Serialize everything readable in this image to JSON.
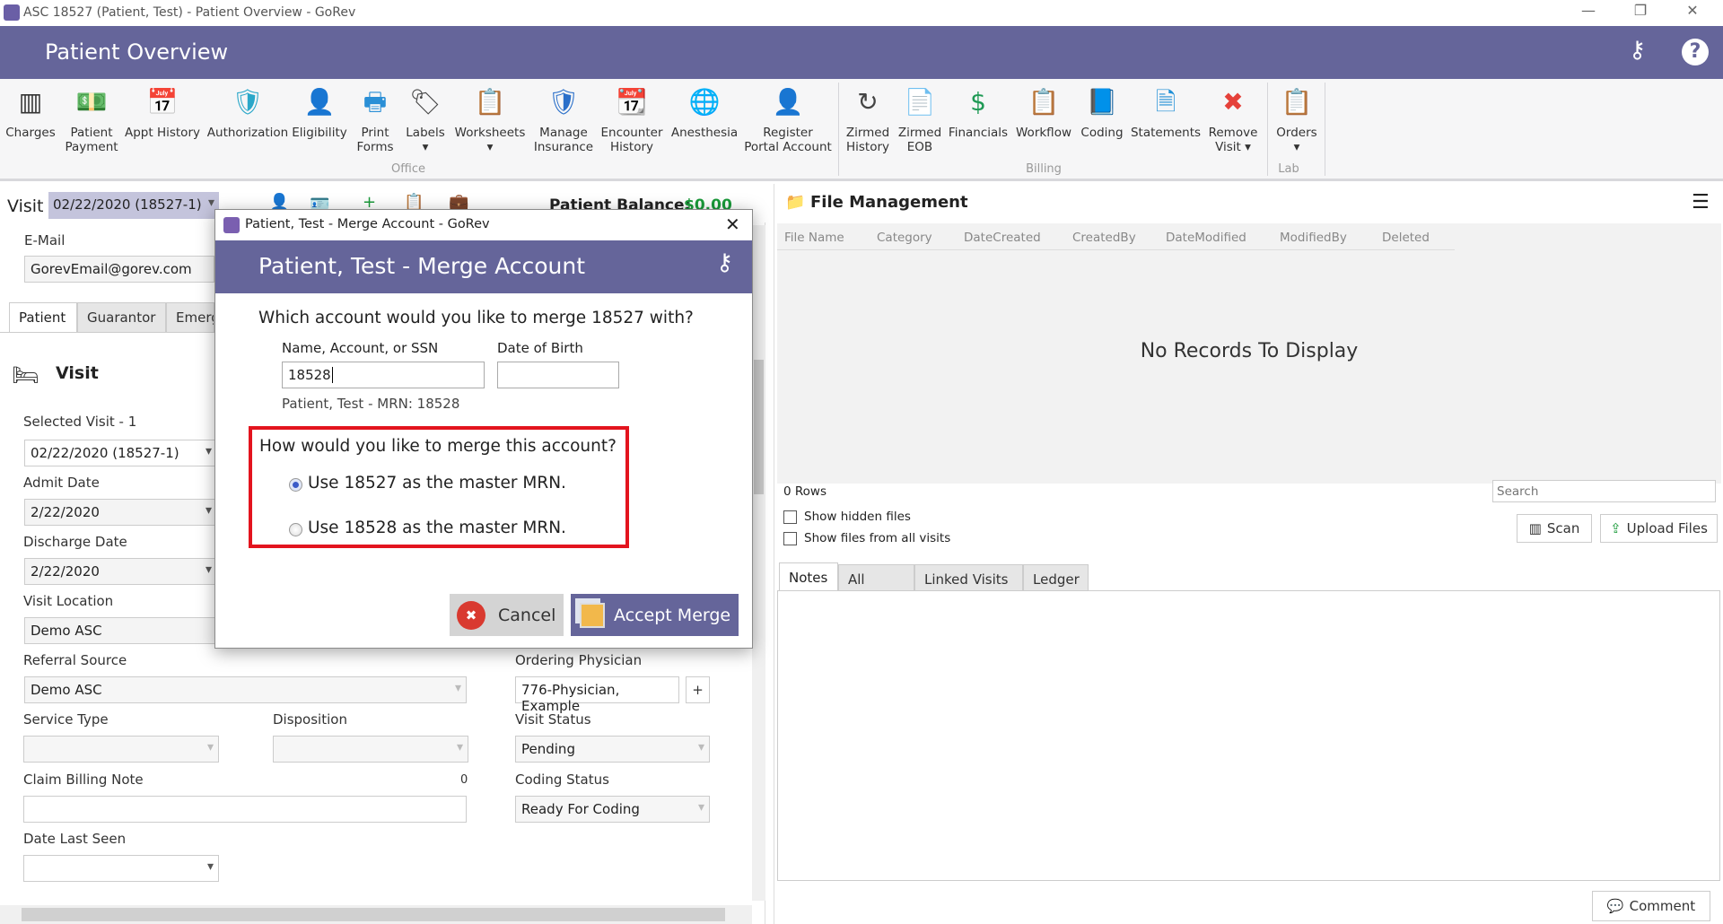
{
  "window": {
    "title": "ASC 18527 (Patient, Test) - Patient Overview - GoRev",
    "minimize": "—",
    "restore": "❐",
    "close": "✕"
  },
  "header": {
    "title": "Patient Overview",
    "keys_icon": "keys-icon",
    "help_icon": "help-icon"
  },
  "ribbon": {
    "items": [
      {
        "label": "Charges",
        "icon": "barcode-icon",
        "glyph": "▥",
        "color": "#333333"
      },
      {
        "label": "Patient\nPayment",
        "icon": "payment-icon",
        "glyph": "💵",
        "color": "#2a9a4a"
      },
      {
        "label": "Appt History",
        "icon": "calendar-clock-icon",
        "glyph": "📅",
        "color": "#d33"
      },
      {
        "label": "Authorization",
        "icon": "shield-check-icon",
        "glyph": "🛡",
        "color": "#2aa7c9"
      },
      {
        "label": "Eligibility",
        "icon": "user-check-icon",
        "glyph": "👤",
        "color": "#333"
      },
      {
        "label": "Print\nForms",
        "icon": "printer-icon",
        "glyph": "🖶",
        "color": "#2a8fd6"
      },
      {
        "label": "Labels\n▾",
        "icon": "tag-icon",
        "glyph": "🏷",
        "color": "#444"
      },
      {
        "label": "Worksheets\n▾",
        "icon": "worksheets-icon",
        "glyph": "📋",
        "color": "#e07b2a"
      },
      {
        "label": "Manage\nInsurance",
        "icon": "insurance-icon",
        "glyph": "🛡",
        "color": "#2a6fc9"
      },
      {
        "label": "Encounter\nHistory",
        "icon": "encounter-history-icon",
        "glyph": "📆",
        "color": "#2a9a4a"
      },
      {
        "label": "Anesthesia",
        "icon": "anesthesia-icon",
        "glyph": "🌐",
        "color": "#1f63c4"
      },
      {
        "label": "Register\nPortal Account",
        "icon": "register-user-icon",
        "glyph": "👤",
        "color": "#333"
      },
      {
        "label": "Zirmed\nHistory",
        "icon": "history-icon",
        "glyph": "↻",
        "color": "#444"
      },
      {
        "label": "Zirmed\nEOB",
        "icon": "eob-icon",
        "glyph": "📄",
        "color": "#e07b2a"
      },
      {
        "label": "Financials",
        "icon": "dollar-icon",
        "glyph": "$",
        "color": "#1f9a55"
      },
      {
        "label": "Workflow",
        "icon": "workflow-icon",
        "glyph": "📋",
        "color": "#2a8fd6"
      },
      {
        "label": "Coding",
        "icon": "book-icon",
        "glyph": "📘",
        "color": "#2a6fc9"
      },
      {
        "label": "Statements",
        "icon": "statements-icon",
        "glyph": "🗎",
        "color": "#1f8fd6"
      },
      {
        "label": "Remove\nVisit ▾",
        "icon": "remove-icon",
        "glyph": "✖",
        "color": "#e5413a"
      },
      {
        "label": "Orders\n▾",
        "icon": "orders-icon",
        "glyph": "📋",
        "color": "#e07b2a"
      }
    ],
    "groups": [
      "Office",
      "Billing",
      "Lab"
    ]
  },
  "visitbar": {
    "label": "Visit",
    "value": "02/22/2020 (18527-1)",
    "balance_label": "Patient Balance:",
    "balance": "$0.00"
  },
  "left": {
    "email_label": "E-Mail",
    "email": "GorevEmail@gorev.com",
    "tabs": [
      "Patient",
      "Guarantor",
      "Emerg"
    ],
    "section": "Visit",
    "selected_visit_label": "Selected Visit - 1",
    "selected_visit": "02/22/2020 (18527-1)",
    "admit_label": "Admit Date",
    "admit": "2/22/2020",
    "discharge_label": "Discharge Date",
    "discharge": "2/22/2020",
    "location_label": "Visit Location",
    "location": "Demo ASC",
    "referral_label": "Referral Source",
    "referral": "Demo ASC",
    "ordering_label": "Ordering Physician",
    "ordering": "776-Physician, Example",
    "add": "+",
    "service_label": "Service Type",
    "disposition_label": "Disposition",
    "status_label": "Visit Status",
    "status": "Pending",
    "claim_note_label": "Claim Billing Note",
    "claim_note_count": "0",
    "coding_label": "Coding Status",
    "coding": "Ready For Coding",
    "last_seen_label": "Date Last Seen"
  },
  "right": {
    "title": "File Management",
    "columns": [
      "File Name",
      "Category",
      "DateCreated",
      "CreatedBy",
      "DateModified",
      "ModifiedBy",
      "Deleted"
    ],
    "empty": "No Records To Display",
    "rows": "0 Rows",
    "search_placeholder": "Search",
    "show_hidden": "Show hidden files",
    "show_all": "Show files from all visits",
    "scan": "Scan",
    "upload": "Upload Files",
    "note_tabs": [
      "Notes",
      "All Notes",
      "Linked Visits",
      "Ledger"
    ],
    "comment": "Comment"
  },
  "dialog": {
    "window_title": "Patient, Test - Merge Account - GoRev",
    "title": "Patient, Test - Merge Account",
    "question": "Which account would you like to merge 18527 with?",
    "search_label": "Name, Account, or SSN",
    "search_value": "18528",
    "dob_label": "Date of Birth",
    "dob_value": "",
    "match": "Patient, Test - MRN: 18528",
    "merge_question": "How would you like to merge this account?",
    "options": [
      {
        "label": "Use 18527 as the master MRN.",
        "selected": true
      },
      {
        "label": "Use 18528 as the master MRN.",
        "selected": false
      }
    ],
    "cancel": "Cancel",
    "accept": "Accept Merge",
    "highlight_color": "#e3141e",
    "accent": "#65659a"
  }
}
